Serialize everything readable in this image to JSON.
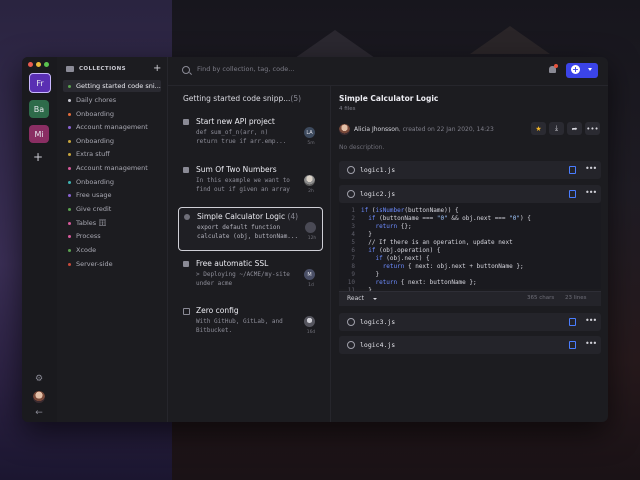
{
  "workspaces": [
    {
      "label": "Fr",
      "color": "#6a37c9"
    },
    {
      "label": "Ba",
      "color": "#2e6b4a"
    },
    {
      "label": "Mi",
      "color": "#8a2e63"
    }
  ],
  "sidebar": {
    "header": "COLLECTIONS",
    "items": [
      {
        "label": "Getting started code sni...",
        "color": "#5aa14f",
        "active": true
      },
      {
        "label": "Daily chores",
        "color": "#c9c9d1"
      },
      {
        "label": "Onboarding",
        "color": "#e36c3a"
      },
      {
        "label": "Account management",
        "color": "#8a63d2"
      },
      {
        "label": "Onboarding",
        "color": "#c8a53c"
      },
      {
        "label": "Extra stuff",
        "color": "#c8a53c"
      },
      {
        "label": "Account management",
        "color": "#d65a9a"
      },
      {
        "label": "Onboarding",
        "color": "#3fb3b3"
      },
      {
        "label": "Free usage",
        "color": "#8a63d2"
      },
      {
        "label": "Give credit",
        "color": "#5aa14f"
      },
      {
        "label": "Tables 🗄",
        "color": "#d65a9a"
      },
      {
        "label": "Process",
        "color": "#d65a9a"
      },
      {
        "label": "Xcode",
        "color": "#5aa14f"
      },
      {
        "label": "Server-side",
        "color": "#c94a3a"
      }
    ]
  },
  "search": {
    "placeholder": "Find by collection, tag, code..."
  },
  "list": {
    "title": "Getting started code snipp...",
    "count": "(5)",
    "cards": [
      {
        "title": "Start new API project",
        "count": "",
        "lines": [
          "def sum_of_n(arr, n)",
          "return true if arr.emp..."
        ],
        "avatar": "LA",
        "time": "5m"
      },
      {
        "title": "Sum Of Two Numbers",
        "count": "",
        "lines": [
          "In this example we want to",
          "find out if given an array"
        ],
        "avatar": "",
        "time": "2h"
      },
      {
        "title": "Simple Calculator Logic",
        "count": "(4)",
        "lines": [
          "export default function",
          "calculate (obj,  buttonNam..."
        ],
        "avatar": "",
        "time": "12h"
      },
      {
        "title": "Free automatic SSL",
        "count": "",
        "lines": [
          "> Deploying ~/ACME/my-site",
          "under acme"
        ],
        "avatar": "M",
        "time": "1d"
      },
      {
        "title": "Zero config",
        "count": "",
        "lines": [
          "With GitHub, GitLab, and",
          "Bitbucket."
        ],
        "avatar": "",
        "time": "16d"
      }
    ]
  },
  "detail": {
    "title": "Simple Calculator Logic",
    "subtitle": "4 files",
    "author": "Alicia Jhonsson",
    "created": ", created on 22 Jan 2020, 14:23",
    "description": "No description.",
    "files": [
      "logic1.js",
      "logic2.js",
      "logic3.js",
      "logic4.js"
    ],
    "code_lines": [
      "if (isNumber(buttonName)) {",
      "  if (buttonName === \"0\" && obj.next === \"0\") {",
      "    return {};",
      "  }",
      "  // If there is an operation, update next",
      "  if (obj.operation) {",
      "    if (obj.next) {",
      "      return { next: obj.next + buttonName };",
      "    }",
      "    return { next: buttonName };",
      "  }"
    ],
    "language": "React",
    "chars": "365 chars",
    "lines": "23 lines"
  }
}
